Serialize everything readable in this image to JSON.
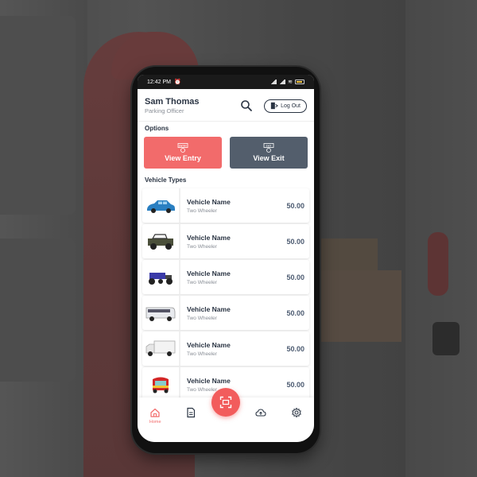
{
  "status_bar": {
    "time": "12:42 PM"
  },
  "header": {
    "user_name": "Sam Thomas",
    "user_role": "Parking Officer",
    "logout_label": "Log Out"
  },
  "options": {
    "section_label": "Options",
    "entry_icon_text": "ENTRY",
    "entry_label": "View Entry",
    "exit_icon_text": "EXIT",
    "exit_label": "View Exit"
  },
  "vehicles": {
    "section_label": "Vehicle Types",
    "items": [
      {
        "name": "Vehicle Name",
        "type": "Two Wheeler",
        "price": "50.00",
        "icon": "car-icon"
      },
      {
        "name": "Vehicle Name",
        "type": "Two Wheeler",
        "price": "50.00",
        "icon": "jeep-icon"
      },
      {
        "name": "Vehicle Name",
        "type": "Two Wheeler",
        "price": "50.00",
        "icon": "motorcycle-icon"
      },
      {
        "name": "Vehicle Name",
        "type": "Two Wheeler",
        "price": "50.00",
        "icon": "bus-icon"
      },
      {
        "name": "Vehicle Name",
        "type": "Two Wheeler",
        "price": "50.00",
        "icon": "truck-icon"
      },
      {
        "name": "Vehicle Name",
        "type": "Two Wheeler",
        "price": "50.00",
        "icon": "tuk-tuk-icon"
      }
    ]
  },
  "bottom_nav": {
    "home_label": "Home"
  },
  "colors": {
    "accent": "#f26b6b",
    "dark": "#535e6c",
    "text": "#2a3443"
  }
}
